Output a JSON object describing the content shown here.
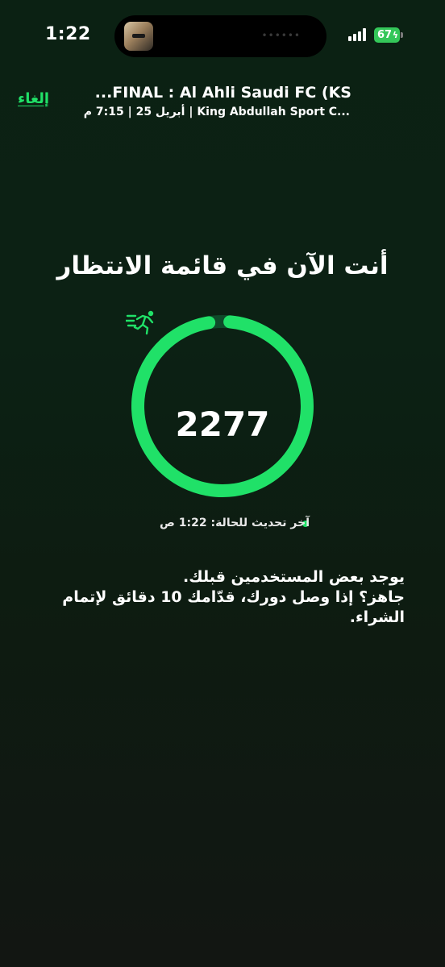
{
  "status_bar": {
    "time": "1:22",
    "battery": "67",
    "signal_bars": 4
  },
  "header": {
    "cancel_label": "إلغاء",
    "event_title": "...FINAL :  Al Ahli Saudi FC (KS",
    "event_subtitle": "أبريل 25 | 7:15 م | King Abdullah Sport C..."
  },
  "queue": {
    "heading": "أنت الآن في قائمة الانتظار",
    "number": "2277",
    "progress_fraction": 0.96,
    "last_update": "آخر تحديث للحالة: 1:22 ص"
  },
  "message": {
    "line1": "يوجد بعض المستخدمين قبلك.",
    "line2": "جاهز؟ إذا وصل دورك، قدّامك 10 دقائق لإتمام الشراء."
  },
  "colors": {
    "accent": "#20e168",
    "ring_track": "#0f4a2a",
    "background_top": "#0b2113",
    "background_bottom": "#121612"
  },
  "icons": {
    "queue_icon": "runner-icon",
    "status_icon": "status-dot"
  }
}
